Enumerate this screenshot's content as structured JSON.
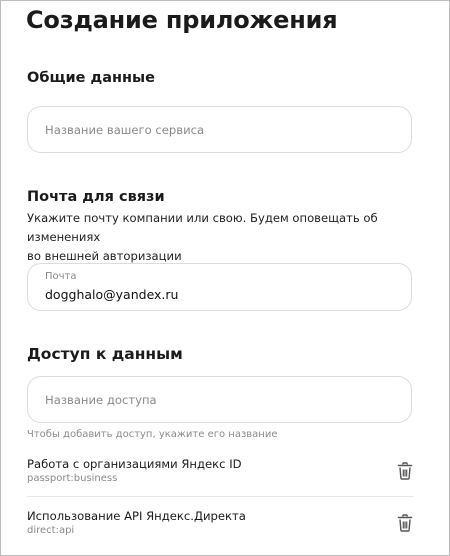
{
  "page": {
    "title": "Создание приложения"
  },
  "general": {
    "heading": "Общие данные",
    "service_name_placeholder": "Название вашего сервиса"
  },
  "contact": {
    "heading": "Почта для связи",
    "description_line1": "Укажите почту компании или свою. Будем оповещать об изменениях",
    "description_line2": "во внешней авторизации",
    "email_label": "Почта",
    "email_value": "dogghalo@yandex.ru"
  },
  "access": {
    "heading": "Доступ к данным",
    "access_name_placeholder": "Название доступа",
    "hint": "Чтобы добавить доступ, укажите его название",
    "items": [
      {
        "title": "Работа с организациями Яндекс ID",
        "scope": "passport:business",
        "icon": "trash-icon"
      },
      {
        "title": "Использование API Яндекс.Директа",
        "scope": "direct:api",
        "icon": "trash-icon"
      }
    ]
  }
}
